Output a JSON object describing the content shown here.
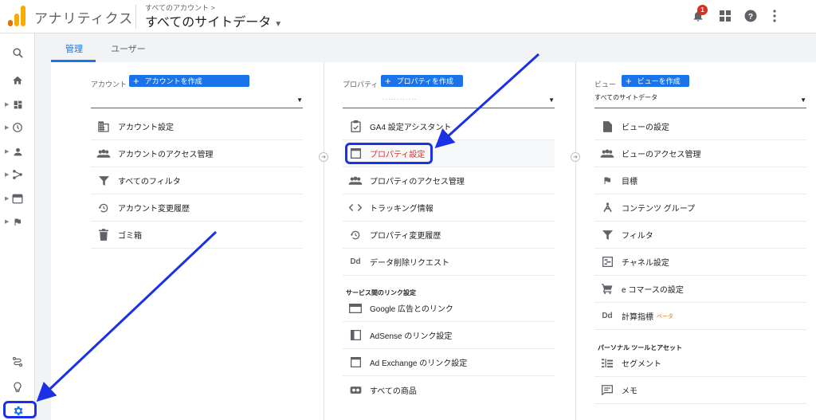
{
  "header": {
    "app_title": "アナリティクス",
    "breadcrumb": "すべてのアカウント >",
    "property_selector": "すべてのサイトデータ",
    "notification_count": "1"
  },
  "tabs": [
    {
      "label": "管理",
      "active": true
    },
    {
      "label": "ユーザー",
      "active": false
    }
  ],
  "account_column": {
    "heading": "アカウント",
    "create_button": "アカウントを作成",
    "dropdown_value": "",
    "items": [
      {
        "label": "アカウント設定",
        "icon": "building-icon"
      },
      {
        "label": "アカウントのアクセス管理",
        "icon": "people-icon"
      },
      {
        "label": "すべてのフィルタ",
        "icon": "filter-icon"
      },
      {
        "label": "アカウント変更履歴",
        "icon": "history-icon"
      },
      {
        "label": "ゴミ箱",
        "icon": "trash-icon"
      }
    ]
  },
  "property_column": {
    "heading": "プロパティ",
    "create_button": "プロパティを作成",
    "dropdown_value": "- - - - - - - - - - - -",
    "items": [
      {
        "label": "GA4 設定アシスタント",
        "icon": "checklist-icon"
      },
      {
        "label": "プロパティ設定",
        "icon": "window-icon",
        "selected": true
      },
      {
        "label": "プロパティのアクセス管理",
        "icon": "people-icon"
      },
      {
        "label": "トラッキング情報",
        "icon": "code-icon"
      },
      {
        "label": "プロパティ変更履歴",
        "icon": "history-icon"
      },
      {
        "label": "データ削除リクエスト",
        "icon": "dd-icon"
      }
    ],
    "section_heading": "サービス間のリンク設定",
    "link_items": [
      {
        "label": "Google 広告とのリンク",
        "icon": "ads-icon"
      },
      {
        "label": "AdSense のリンク設定",
        "icon": "adsense-icon"
      },
      {
        "label": "Ad Exchange のリンク設定",
        "icon": "adexchange-icon"
      },
      {
        "label": "すべての商品",
        "icon": "link-products-icon"
      }
    ]
  },
  "view_column": {
    "heading": "ビュー",
    "create_button": "ビューを作成",
    "dropdown_value": "すべてのサイトデータ",
    "items": [
      {
        "label": "ビューの設定",
        "icon": "document-icon"
      },
      {
        "label": "ビューのアクセス管理",
        "icon": "people-icon"
      },
      {
        "label": "目標",
        "icon": "flag-icon"
      },
      {
        "label": "コンテンツ グループ",
        "icon": "content-group-icon"
      },
      {
        "label": "フィルタ",
        "icon": "filter-icon"
      },
      {
        "label": "チャネル設定",
        "icon": "channel-icon"
      },
      {
        "label": "e コマースの設定",
        "icon": "cart-icon"
      },
      {
        "label": "計算指標",
        "icon": "dd-icon",
        "badge": "ベータ"
      }
    ],
    "section_heading": "パーソナル ツールとアセット",
    "personal_items": [
      {
        "label": "セグメント",
        "icon": "segment-icon"
      },
      {
        "label": "メモ",
        "icon": "note-icon"
      }
    ]
  },
  "colors": {
    "accent": "#1a73e8",
    "selected_text": "#d93025",
    "annotation": "#1a31e6",
    "logo_orange": "#f9ab00",
    "logo_dark_orange": "#e37400"
  }
}
